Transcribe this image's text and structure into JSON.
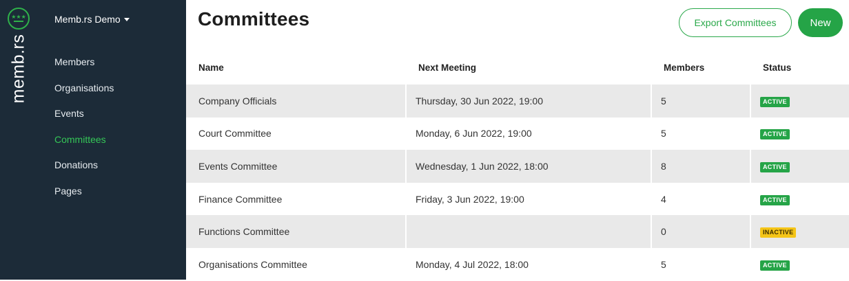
{
  "brand": {
    "logo_text": "memb.rs",
    "logo_stars": "★★★",
    "accent": "#2fb14a"
  },
  "sidebar": {
    "org_switcher": "Memb.rs Demo",
    "items": [
      {
        "label": "Members"
      },
      {
        "label": "Organisations"
      },
      {
        "label": "Events"
      },
      {
        "label": "Committees",
        "active": true
      },
      {
        "label": "Donations"
      },
      {
        "label": "Pages"
      }
    ]
  },
  "header": {
    "title": "Committees",
    "export_label": "Export Committees",
    "new_label": "New"
  },
  "table": {
    "columns": [
      "Name",
      "Next Meeting",
      "Members",
      "Status"
    ],
    "rows": [
      {
        "name": "Company Officials",
        "next_meeting": "Thursday, 30 Jun 2022, 19:00",
        "members": "5",
        "status": "ACTIVE"
      },
      {
        "name": "Court Committee",
        "next_meeting": "Monday, 6 Jun 2022, 19:00",
        "members": "5",
        "status": "ACTIVE"
      },
      {
        "name": "Events Committee",
        "next_meeting": "Wednesday, 1 Jun 2022, 18:00",
        "members": "8",
        "status": "ACTIVE"
      },
      {
        "name": "Finance Committee",
        "next_meeting": "Friday, 3 Jun 2022, 19:00",
        "members": "4",
        "status": "ACTIVE"
      },
      {
        "name": "Functions Committee",
        "next_meeting": "",
        "members": "0",
        "status": "INACTIVE"
      },
      {
        "name": "Organisations Committee",
        "next_meeting": "Monday, 4 Jul 2022, 18:00",
        "members": "5",
        "status": "ACTIVE"
      }
    ]
  },
  "colors": {
    "sidebar_bg": "#1c2b38",
    "active_nav": "#35c757",
    "active_badge": "#25a447",
    "inactive_badge": "#f5c518",
    "row_stripe": "#e9e9e9"
  }
}
